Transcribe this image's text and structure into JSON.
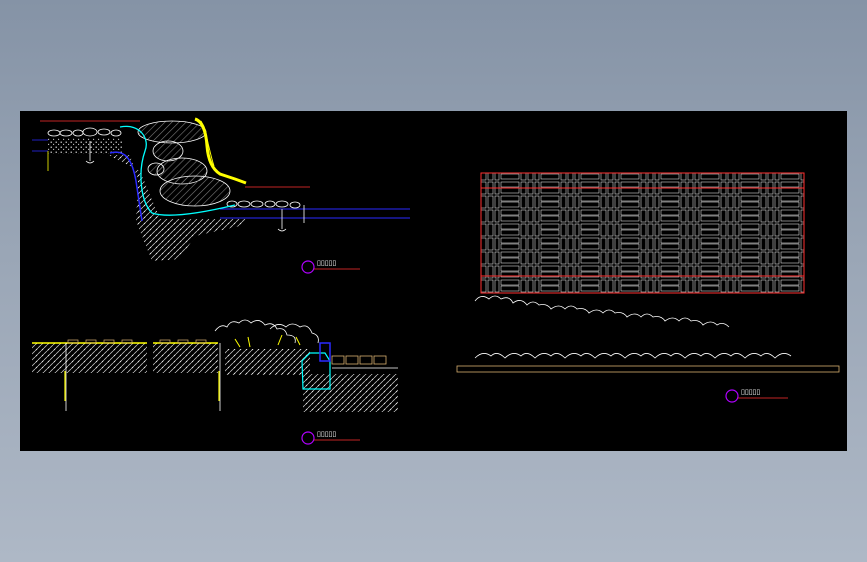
{
  "drawing": {
    "background": "#000000",
    "details": [
      {
        "id": "detail-1",
        "label": "▯▯▯▯▯"
      },
      {
        "id": "detail-2",
        "label": "▯▯▯▯▯"
      },
      {
        "id": "detail-3",
        "label": "▯▯▯▯▯"
      }
    ]
  },
  "colors": {
    "red": "#ff3030",
    "blue": "#2a2aff",
    "yellow": "#ffff00",
    "cyan": "#00ffff",
    "white": "#ffffff",
    "tan": "#d8b070",
    "magenta": "#b000ff"
  }
}
